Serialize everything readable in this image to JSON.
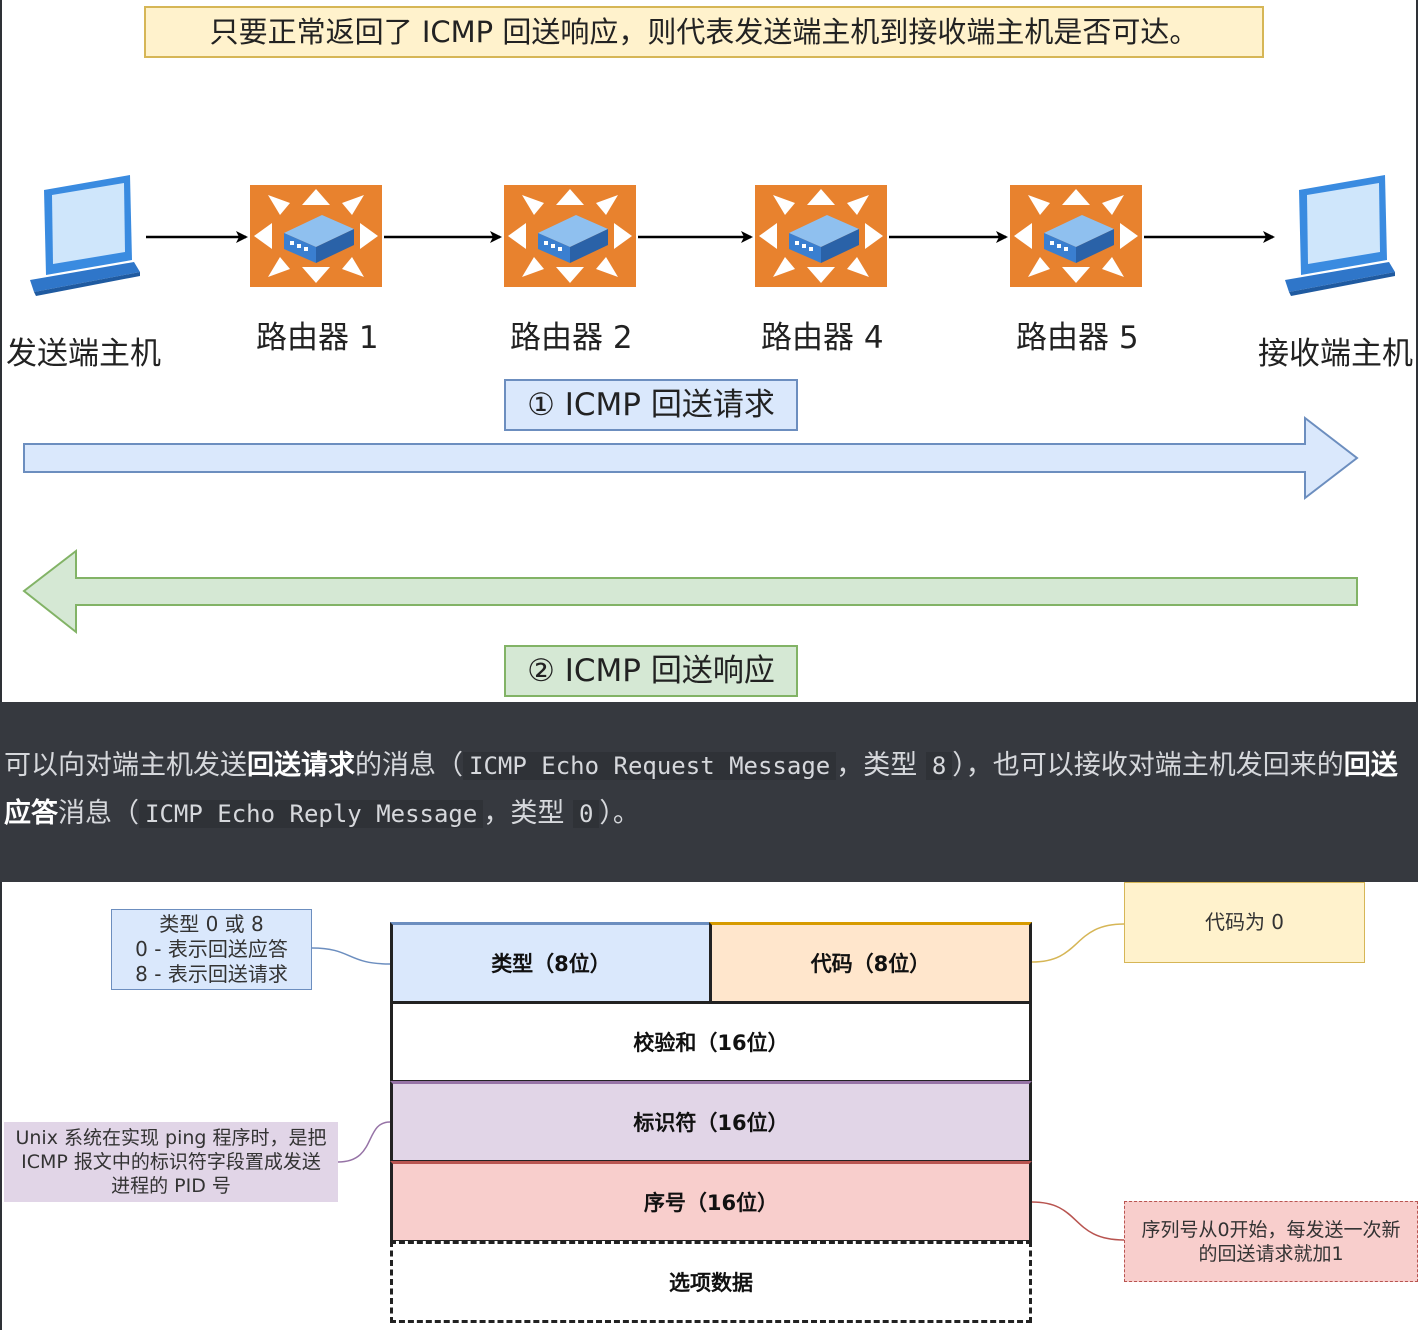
{
  "top": {
    "summary": "只要正常返回了 ICMP 回送响应，则代表发送端主机到接收端主机是否可达。",
    "nodes": {
      "sender": "发送端主机",
      "router1": "路由器 1",
      "router2": "路由器 2",
      "router4": "路由器 4",
      "router5": "路由器 5",
      "receiver": "接收端主机"
    },
    "request_label": "① ICMP 回送请求",
    "reply_label": "② ICMP 回送响应"
  },
  "paragraph": {
    "p1": "可以向对端主机发送",
    "b1": "回送请求",
    "p2": "的消息（",
    "c1": "ICMP Echo Request Message",
    "p3": "，类型",
    "c2": "8",
    "p4": "），也可以接收对端主机发回来的",
    "b2": "回送应答",
    "p5": "消息（",
    "c3": "ICMP Echo Reply Message",
    "p6": "，类型",
    "c4": "0",
    "p7": "）。"
  },
  "packet": {
    "type_field": "类型（8位）",
    "code_field": "代码（8位）",
    "checksum_field": "校验和（16位）",
    "identifier_field": "标识符（16位）",
    "sequence_field": "序号（16位）",
    "options_field": "选项数据"
  },
  "notes": {
    "type_line1": "类型 0 或 8",
    "type_line2": "0 - 表示回送应答",
    "type_line3": "8 - 表示回送请求",
    "code": "代码为 0",
    "identifier_line1": "Unix 系统在实现 ping 程序时，是把",
    "identifier_line2": "ICMP 报文中的标识符字段置成发送",
    "identifier_line3": "进程的 PID 号",
    "sequence_line1": "序列号从0开始，每发送一次新",
    "sequence_line2": "的回送请求就加1"
  },
  "colors": {
    "blue_fill": "#dae8fc",
    "blue_stroke": "#6c8ebf",
    "orange_fill": "#ffe6cc",
    "orange_stroke": "#d79b00",
    "purple_fill": "#e1d5e7",
    "purple_stroke": "#9673a6",
    "red_fill": "#f8cecc",
    "red_stroke": "#b85450",
    "green_fill": "#d5e8d4",
    "green_stroke": "#82b366",
    "yellow_fill": "#fff2cc",
    "yellow_stroke": "#d6b656",
    "router_orange": "#e8822e"
  },
  "icons": {
    "host": "laptop-icon",
    "router": "router-icon"
  }
}
